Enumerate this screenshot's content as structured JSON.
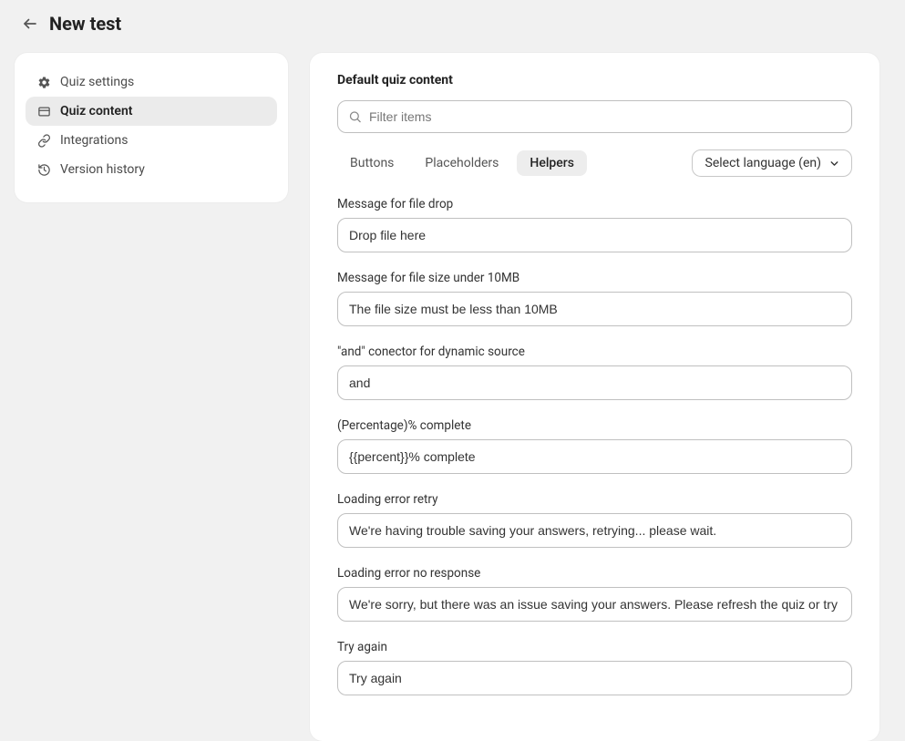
{
  "header": {
    "title": "New test"
  },
  "sidebar": {
    "items": [
      {
        "key": "quiz-settings",
        "label": "Quiz settings"
      },
      {
        "key": "quiz-content",
        "label": "Quiz content"
      },
      {
        "key": "integrations",
        "label": "Integrations"
      },
      {
        "key": "version-history",
        "label": "Version history"
      }
    ]
  },
  "main": {
    "title": "Default quiz content",
    "filter_placeholder": "Filter items",
    "tabs": [
      {
        "key": "buttons",
        "label": "Buttons"
      },
      {
        "key": "placeholders",
        "label": "Placeholders"
      },
      {
        "key": "helpers",
        "label": "Helpers"
      }
    ],
    "language_selector": "Select language (en)",
    "fields": [
      {
        "label": "Message for file drop",
        "value": "Drop file here"
      },
      {
        "label": "Message for file size under 10MB",
        "value": "The file size must be less than 10MB"
      },
      {
        "label": "\"and\" conector for dynamic source",
        "value": "and"
      },
      {
        "label": "(Percentage)% complete",
        "value": "{{percent}}% complete"
      },
      {
        "label": "Loading error retry",
        "value": "We're having trouble saving your answers, retrying... please wait."
      },
      {
        "label": "Loading error no response",
        "value": "We're sorry, but there was an issue saving your answers. Please refresh the quiz or try"
      },
      {
        "label": "Try again",
        "value": "Try again"
      }
    ]
  }
}
